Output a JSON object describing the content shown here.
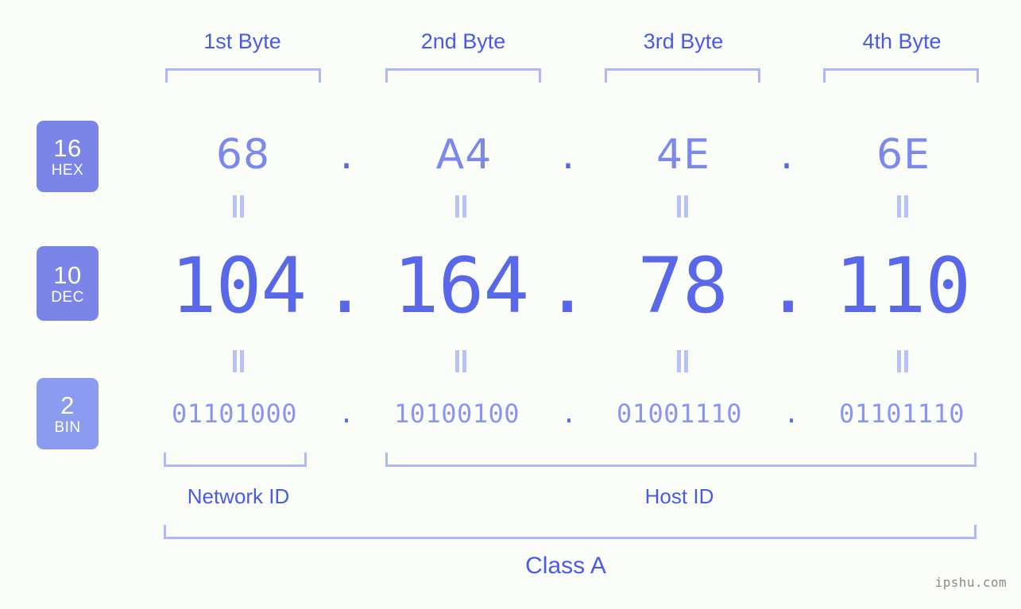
{
  "background_color": "#fbfdf8",
  "accent_color": "#5868e8",
  "bracket_color": "#aeb7f7",
  "byte_headers": [
    {
      "label": "1st Byte"
    },
    {
      "label": "2nd Byte"
    },
    {
      "label": "3rd Byte"
    },
    {
      "label": "4th Byte"
    }
  ],
  "rows": {
    "hex": {
      "badge_number": "16",
      "badge_name": "HEX",
      "badge_color": "#7b85e8",
      "text_color": "#7b88ee",
      "separator": ".",
      "values": [
        "68",
        "A4",
        "4E",
        "6E"
      ]
    },
    "dec": {
      "badge_number": "10",
      "badge_name": "DEC",
      "badge_color": "#7b85e8",
      "text_color": "#5868e8",
      "separator": ".",
      "values": [
        "104",
        "164",
        "78",
        "110"
      ]
    },
    "bin": {
      "badge_number": "2",
      "badge_name": "BIN",
      "badge_color": "#8b9bf0",
      "text_color": "#8b95ee",
      "separator": ".",
      "values": [
        "01101000",
        "10100100",
        "01001110",
        "01101110"
      ]
    }
  },
  "equals_marks": {
    "hex_to_dec": [
      "||",
      "||",
      "||",
      "||"
    ],
    "dec_to_bin": [
      "||",
      "||",
      "||",
      "||"
    ]
  },
  "footer": {
    "network_id_label": "Network ID",
    "host_id_label": "Host ID",
    "class_label": "Class A"
  },
  "watermark": "ipshu.com",
  "chart_data": {
    "type": "table",
    "title": "IP Address 104.164.78.110 byte breakdown",
    "columns": [
      "1st Byte",
      "2nd Byte",
      "3rd Byte",
      "4th Byte"
    ],
    "rows": [
      {
        "radix": 16,
        "name": "HEX",
        "values": [
          "68",
          "A4",
          "4E",
          "6E"
        ]
      },
      {
        "radix": 10,
        "name": "DEC",
        "values": [
          "104",
          "164",
          "78",
          "110"
        ]
      },
      {
        "radix": 2,
        "name": "BIN",
        "values": [
          "01101000",
          "10100100",
          "01001110",
          "01101110"
        ]
      }
    ],
    "partitions": [
      {
        "label": "Network ID",
        "bytes": [
          1
        ]
      },
      {
        "label": "Host ID",
        "bytes": [
          2,
          3,
          4
        ]
      },
      {
        "label": "Class A",
        "bytes": [
          1,
          2,
          3,
          4
        ]
      }
    ]
  }
}
